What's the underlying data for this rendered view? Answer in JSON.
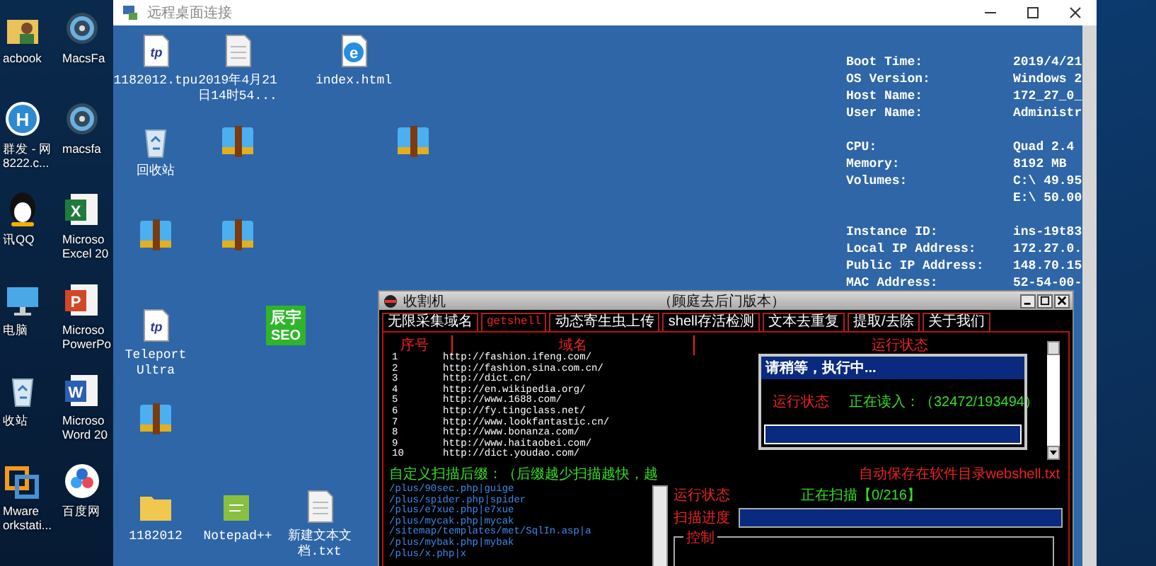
{
  "outer_desktop_icons": [
    {
      "kind": "user-folder",
      "label": [
        "acbook"
      ]
    },
    {
      "kind": "h-circle",
      "glyph": "H",
      "label": [
        "群发 - 网",
        "8222.c..."
      ]
    },
    {
      "kind": "penguin",
      "label": [
        "讯QQ"
      ]
    },
    {
      "kind": "monitor",
      "label": [
        "电脑"
      ]
    },
    {
      "kind": "recycle-bin",
      "label": [
        "收站"
      ]
    },
    {
      "kind": "vmware",
      "label": [
        "Mware",
        "orkstati..."
      ]
    },
    {
      "kind": "fan",
      "label": [
        "MacsFa"
      ]
    },
    {
      "kind": "fan",
      "label": [
        "macsfa"
      ]
    },
    {
      "kind": "excel",
      "glyph": "X",
      "label": [
        "Microso",
        "Excel 20"
      ]
    },
    {
      "kind": "powerpoint",
      "glyph": "P",
      "label": [
        "Microso",
        "PowerPo"
      ]
    },
    {
      "kind": "word",
      "glyph": "W",
      "label": [
        "Microso",
        "Word 20"
      ]
    },
    {
      "kind": "cloud",
      "label": [
        "百度网"
      ]
    }
  ],
  "remote_window": {
    "title": "远程桌面连接",
    "icons": [
      {
        "kind": "doc-tp",
        "glyph": "tp",
        "label": [
          "1182012.tpu"
        ]
      },
      {
        "kind": "document",
        "label": [
          "2019年4月21",
          "日14时54..."
        ]
      },
      {
        "kind": "ie",
        "glyph": "e",
        "label": [
          "index.html"
        ]
      },
      {
        "kind": "recycle-bin",
        "label": [
          "回收站"
        ]
      },
      {
        "kind": "archive"
      },
      {
        "kind": "archive"
      },
      {
        "kind": "archive"
      },
      {
        "kind": "archive"
      },
      {
        "kind": "teleport",
        "glyph": "tp",
        "label": [
          "Teleport",
          "Ultra"
        ]
      },
      {
        "kind": "seo",
        "glyph": "辰宇",
        "glyph_2": "SEO"
      },
      {
        "kind": "archive"
      },
      {
        "kind": "folder",
        "label": [
          "1182012"
        ]
      },
      {
        "kind": "notepad",
        "label": [
          "Notepad++"
        ]
      },
      {
        "kind": "document",
        "label": [
          "新建文本文",
          "档.txt"
        ]
      }
    ],
    "system_info": [
      [
        {
          "label": "Boot Time:",
          "value": "2019/4/21"
        },
        {
          "label": "OS Version:",
          "value": "Windows 2"
        },
        {
          "label": "Host Name:",
          "value": "172_27_0_"
        },
        {
          "label": "User Name:",
          "value": "Administr"
        }
      ],
      [
        {
          "label": "CPU:",
          "value": "Quad 2.4"
        },
        {
          "label": "Memory:",
          "value": "8192 MB"
        },
        {
          "label": "Volumes:",
          "value": "C:\\ 49.95"
        },
        {
          "value": "E:\\ 50.00"
        }
      ],
      [
        {
          "label": "Instance ID:",
          "value": "ins-19t83"
        },
        {
          "label": "Local IP Address:",
          "value": "172.27.0."
        },
        {
          "label": "Public IP Address:",
          "value": "148.70.15"
        },
        {
          "label": "MAC Address:",
          "value": "52-54-00-"
        }
      ]
    ],
    "app": {
      "title": "收割机",
      "subtitle": "（顾庭去后门版本）",
      "tabs": [
        {
          "label": "无限采集域名",
          "selected": false
        },
        {
          "label": "getshell",
          "selected": true
        },
        {
          "label": "动态寄生虫上传",
          "selected": false
        },
        {
          "label": "shell存活检测",
          "selected": false
        },
        {
          "label": "文本去重复",
          "selected": false
        },
        {
          "label": "提取/去除",
          "selected": false
        },
        {
          "label": "关于我们",
          "selected": false
        }
      ],
      "columns": [
        "序号",
        "域名",
        "运行状态"
      ],
      "rows": [
        {
          "index": "1",
          "domain": "http://fashion.ifeng.com/"
        },
        {
          "index": "2",
          "domain": "http://fashion.sina.com.cn/"
        },
        {
          "index": "3",
          "domain": "http://dict.cn/"
        },
        {
          "index": "4",
          "domain": "http://en.wikipedia.org/"
        },
        {
          "index": "5",
          "domain": "http://www.1688.com/"
        },
        {
          "index": "6",
          "domain": "http://fy.tingclass.net/"
        },
        {
          "index": "7",
          "domain": "http://www.lookfantastic.cn/"
        },
        {
          "index": "8",
          "domain": "http://www.bonanza.com/"
        },
        {
          "index": "9",
          "domain": "http://www.haitaobei.com/"
        },
        {
          "index": "10",
          "domain": "http://dict.youdao.com/"
        }
      ],
      "suffix_label": "自定义扫描后缀：（后缀越少扫描越快，越",
      "save_note": "自动保存在软件目录webshell.txt",
      "suffixes": [
        "/plus/90sec.php|guige",
        "/plus/spider.php|spider",
        "/plus/e7xue.php|e7xue",
        "/plus/mycak.php|mycak",
        "/sitemap/templates/met/SqlIn.asp|a",
        "/plus/mybak.php|mybak",
        "/plus/x.php|x"
      ],
      "status_label": "运行状态",
      "scan_status": "正在扫描【0/216】",
      "progress_label": "扫描进度",
      "progress": {
        "level": 1
      },
      "control_group": "控制",
      "dialog": {
        "title": "请稍等，执行中...",
        "status_label": "运行状态",
        "status": "正在读入：（32472/193494）",
        "progress": {
          "level": 1
        }
      }
    }
  }
}
